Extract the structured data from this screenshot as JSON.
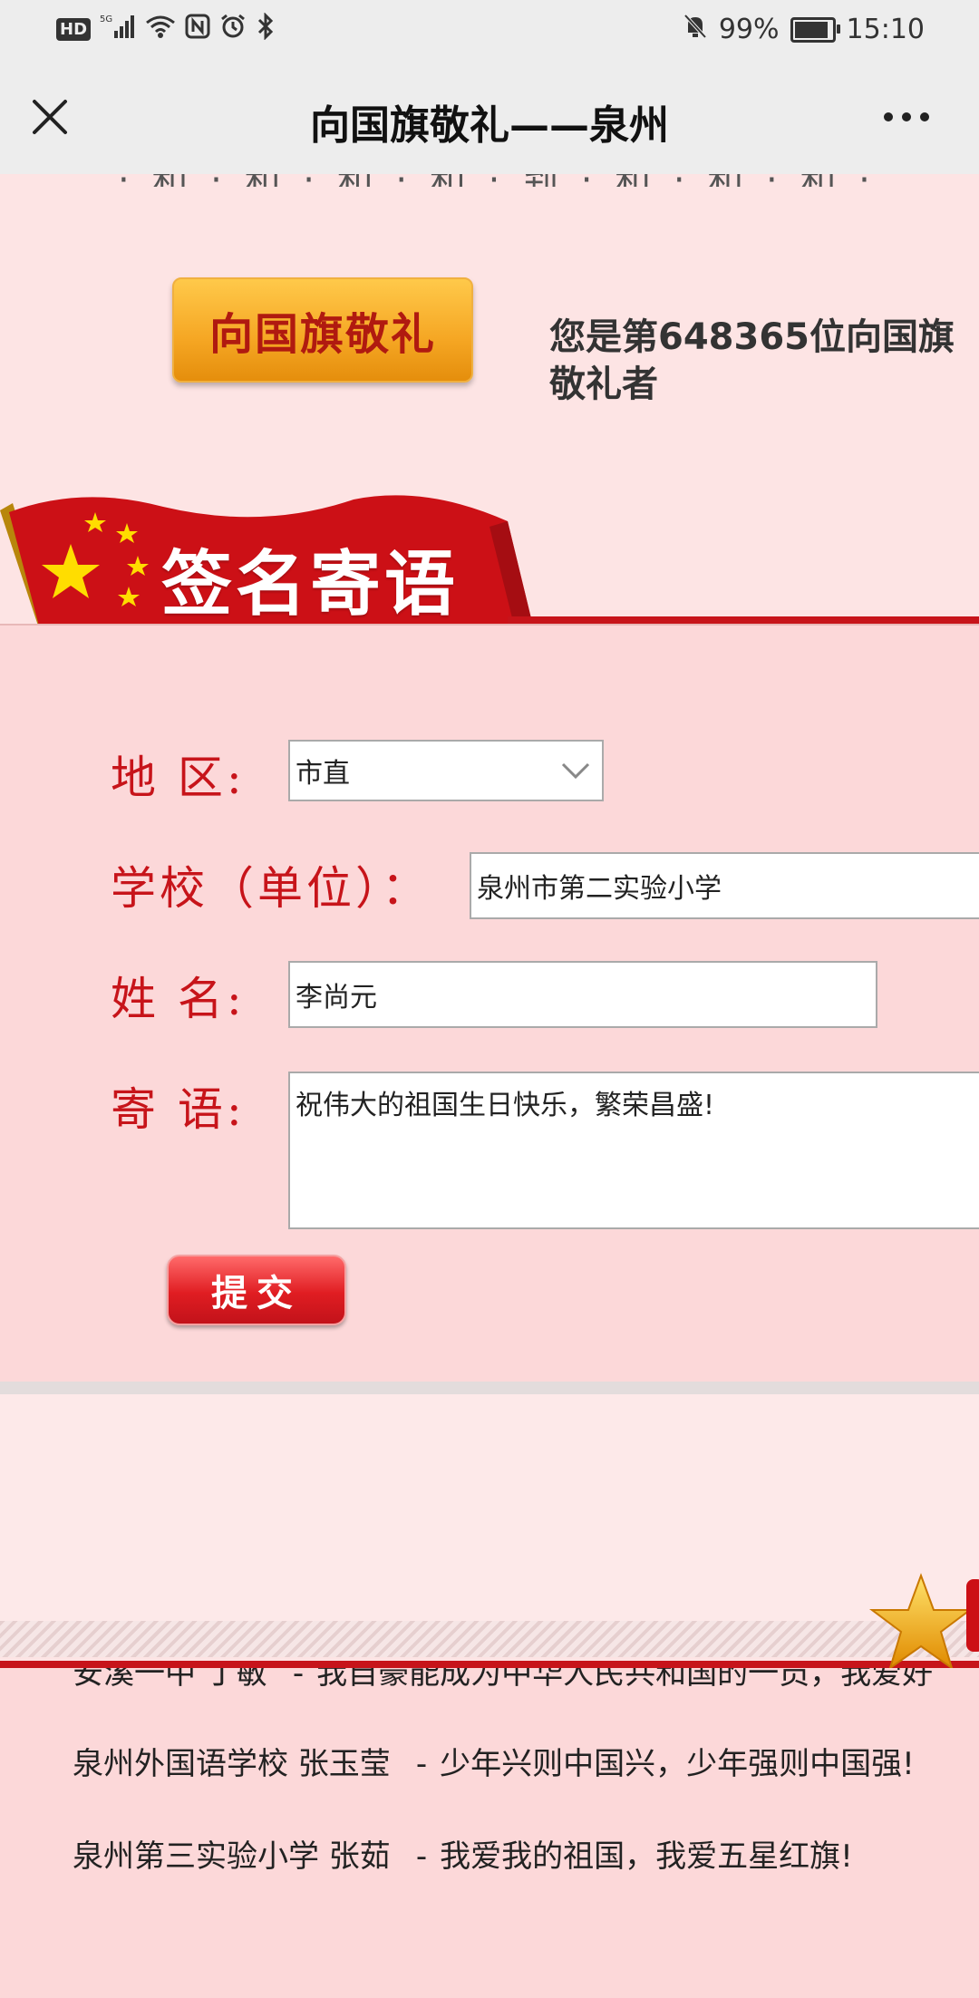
{
  "status_bar": {
    "hd": "HD",
    "network": "5G",
    "battery": "99%",
    "battery_level": 0.99,
    "time": "15:10"
  },
  "nav": {
    "title": "向国旗敬礼——泉州"
  },
  "top_cut_text": "· 和 · 和 · 和 · 和 · 到 · 和 · 和 · 和 ·",
  "salute": {
    "button_label": "向国旗敬礼",
    "count_text": "您是第648365位向国旗敬礼者"
  },
  "banner": {
    "title": "签名寄语"
  },
  "form": {
    "region_label": "地 区:",
    "region_value": "市直",
    "school_label": "学校（单位）：",
    "school_value": "泉州市第二实验小学",
    "name_label": "姓 名:",
    "name_value": "李尚元",
    "message_label": "寄 语:",
    "message_value": "祝伟大的祖国生日快乐，繁荣昌盛!",
    "submit_label": "提交"
  },
  "messages": [
    {
      "author": "安溪一中 丁敏",
      "text": "我自豪能成为中华人民共和国的一员，我爱好"
    },
    {
      "author": "泉州外国语学校 张玉莹",
      "text": "少年兴则中国兴，少年强则中国强!"
    },
    {
      "author": "泉州第三实验小学 张茹",
      "text": "我爱我的祖国，我爱五星红旗!"
    }
  ],
  "colors": {
    "brand_red": "#c7141a",
    "page_bg": "#fde4e4",
    "panel_bg": "#fcd8d9",
    "button_orange": "#f5a623"
  }
}
